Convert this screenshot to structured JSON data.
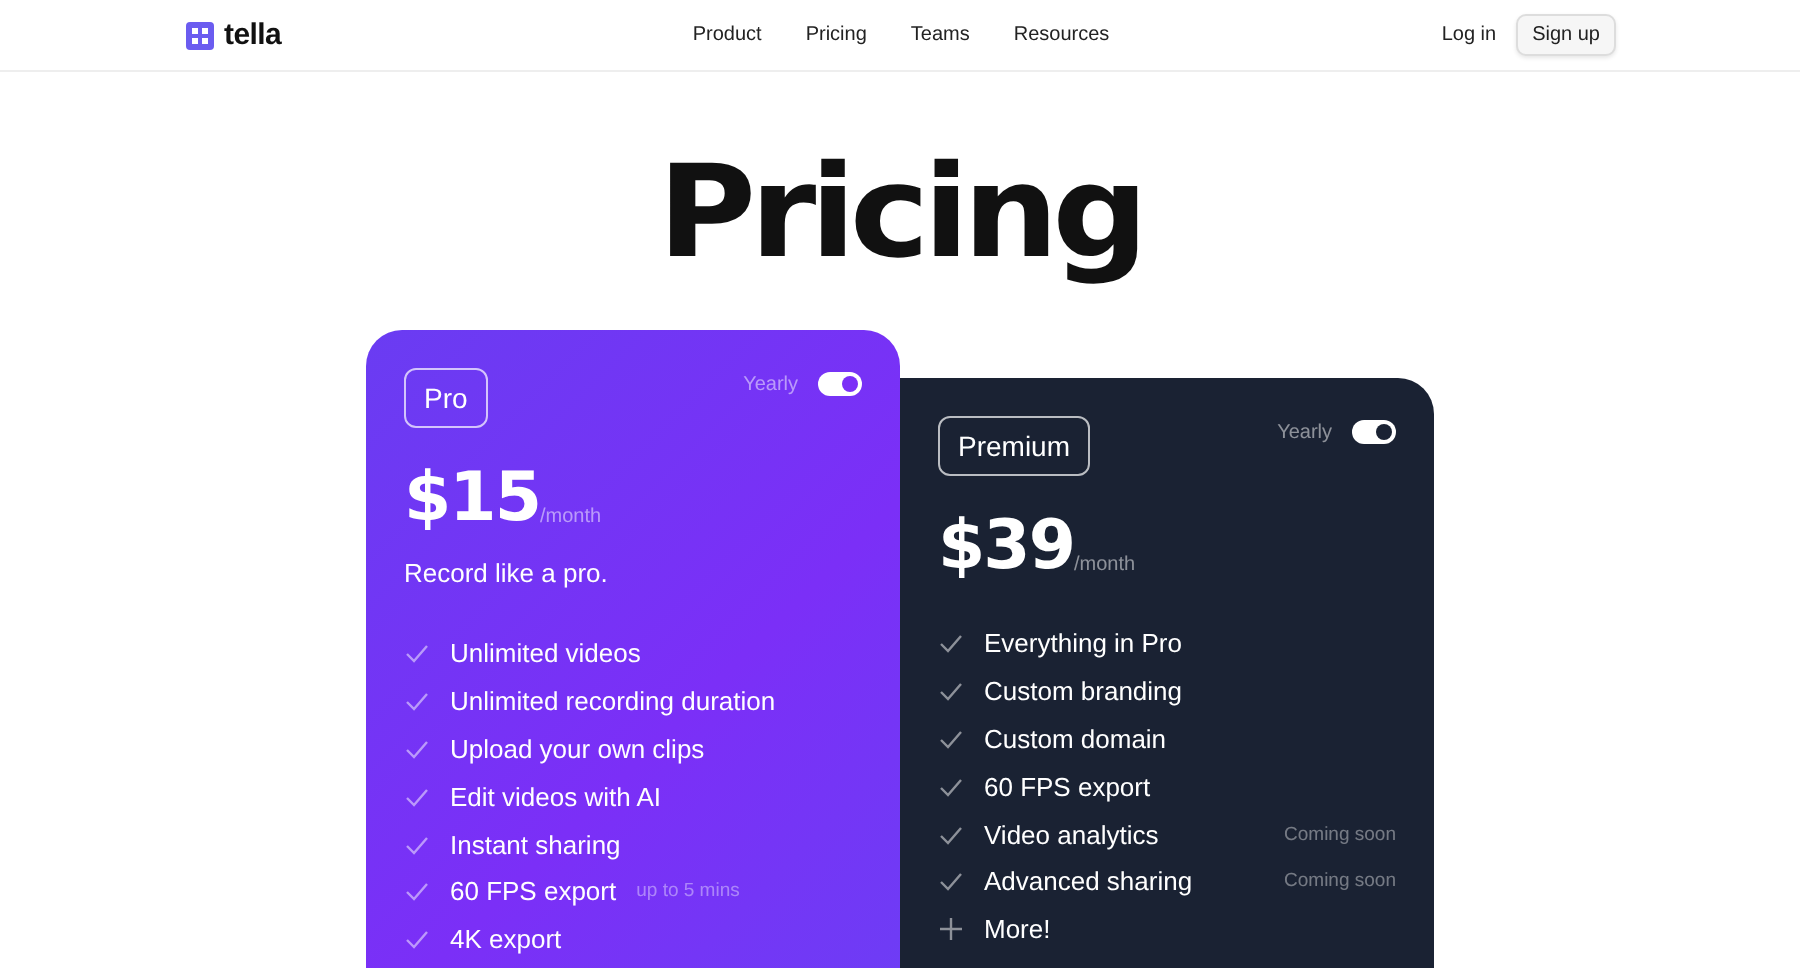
{
  "header": {
    "logo": "tella",
    "nav": [
      {
        "label": "Product"
      },
      {
        "label": "Pricing"
      },
      {
        "label": "Teams"
      },
      {
        "label": "Resources"
      }
    ],
    "login": "Log in",
    "signup": "Sign up"
  },
  "title": "Pricing",
  "plans": [
    {
      "kind": "purple",
      "name": "Pro",
      "billing": "Yearly",
      "yearly_on": true,
      "price": "$15",
      "period": "/month",
      "tagline": "Record like a pro.",
      "features": [
        {
          "kind": "check",
          "text": "Unlimited videos"
        },
        {
          "kind": "check",
          "text": "Unlimited recording duration"
        },
        {
          "kind": "check",
          "text": "Upload your own clips"
        },
        {
          "kind": "check",
          "text": "Edit videos with AI"
        },
        {
          "kind": "check",
          "text": "Instant sharing"
        },
        {
          "kind": "check",
          "text": "60 FPS export",
          "note": "up to 5 mins"
        },
        {
          "kind": "check",
          "text": "4K export"
        }
      ]
    },
    {
      "kind": "dark",
      "name": "Premium",
      "billing": "Yearly",
      "yearly_on": true,
      "price": "$39",
      "period": "/month",
      "features": [
        {
          "kind": "check",
          "text": "Everything in Pro"
        },
        {
          "kind": "check",
          "text": "Custom branding"
        },
        {
          "kind": "check",
          "text": "Custom domain"
        },
        {
          "kind": "check",
          "text": "60 FPS export"
        },
        {
          "kind": "check",
          "text": "Video analytics",
          "note": "Coming soon"
        },
        {
          "kind": "check",
          "text": "Advanced sharing",
          "note": "Coming soon"
        },
        {
          "kind": "plus",
          "text": "More!"
        }
      ]
    }
  ]
}
